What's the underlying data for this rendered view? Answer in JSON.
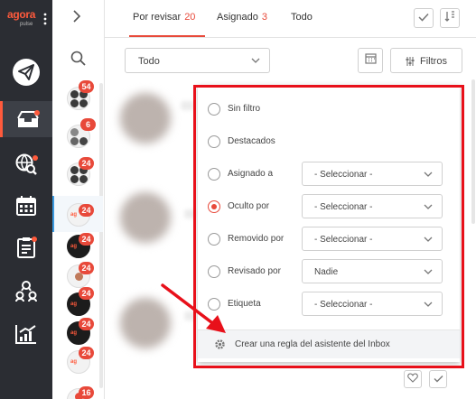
{
  "brand": {
    "logo_text": "agora",
    "logo_sub": "pulse",
    "accent_color": "#ff5a3c"
  },
  "rail": {
    "icons": [
      "paper-plane-icon",
      "inbox-icon",
      "globe-search-icon",
      "calendar-icon",
      "clipboard-icon",
      "users-network-icon",
      "chart-icon"
    ],
    "active": "inbox-icon"
  },
  "accounts": {
    "badges": [
      "54",
      "6",
      "24",
      "24",
      "24",
      "24",
      "24",
      "24",
      "16"
    ]
  },
  "tabs": [
    {
      "label": "Por revisar",
      "count": "20"
    },
    {
      "label": "Asignado",
      "count": "3"
    },
    {
      "label": "Todo"
    }
  ],
  "toolbar": {
    "scope_select": "Todo",
    "filters_label": "Filtros"
  },
  "filter_panel": {
    "options": [
      {
        "label": "Sin filtro",
        "selected": false
      },
      {
        "label": "Destacados",
        "selected": false
      },
      {
        "label": "Asignado a",
        "selected": false,
        "select_value": "- Seleccionar -"
      },
      {
        "label": "Oculto por",
        "selected": true,
        "select_value": "- Seleccionar -"
      },
      {
        "label": "Removido por",
        "selected": false,
        "select_value": "- Seleccionar -"
      },
      {
        "label": "Revisado por",
        "selected": false,
        "select_value": "Nadie"
      },
      {
        "label": "Etiqueta",
        "selected": false,
        "select_value": "- Seleccionar -"
      }
    ],
    "footer_link": "Crear una regla del asistente del Inbox"
  },
  "colors": {
    "badge": "#e8493a",
    "highlight_box": "#e8101a",
    "rail_bg": "#2b2d33"
  }
}
